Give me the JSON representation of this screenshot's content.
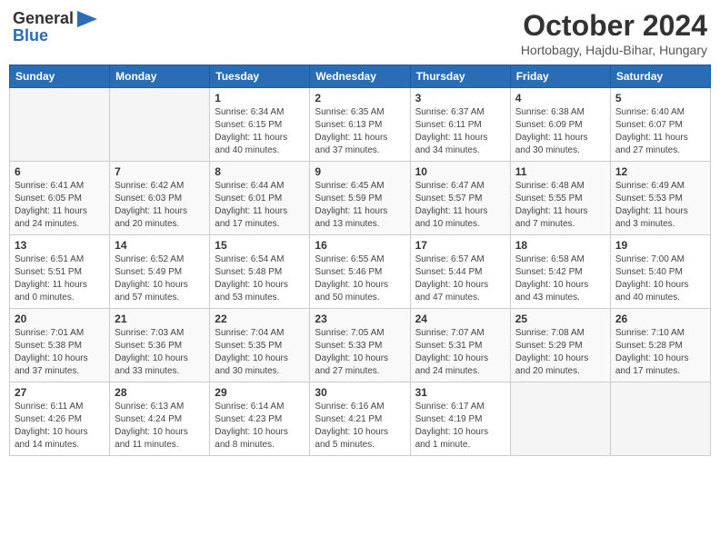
{
  "header": {
    "logo_general": "General",
    "logo_blue": "Blue",
    "month_title": "October 2024",
    "location": "Hortobagy, Hajdu-Bihar, Hungary"
  },
  "days_of_week": [
    "Sunday",
    "Monday",
    "Tuesday",
    "Wednesday",
    "Thursday",
    "Friday",
    "Saturday"
  ],
  "weeks": [
    [
      {
        "day": "",
        "info": ""
      },
      {
        "day": "",
        "info": ""
      },
      {
        "day": "1",
        "info": "Sunrise: 6:34 AM\nSunset: 6:15 PM\nDaylight: 11 hours\nand 40 minutes."
      },
      {
        "day": "2",
        "info": "Sunrise: 6:35 AM\nSunset: 6:13 PM\nDaylight: 11 hours\nand 37 minutes."
      },
      {
        "day": "3",
        "info": "Sunrise: 6:37 AM\nSunset: 6:11 PM\nDaylight: 11 hours\nand 34 minutes."
      },
      {
        "day": "4",
        "info": "Sunrise: 6:38 AM\nSunset: 6:09 PM\nDaylight: 11 hours\nand 30 minutes."
      },
      {
        "day": "5",
        "info": "Sunrise: 6:40 AM\nSunset: 6:07 PM\nDaylight: 11 hours\nand 27 minutes."
      }
    ],
    [
      {
        "day": "6",
        "info": "Sunrise: 6:41 AM\nSunset: 6:05 PM\nDaylight: 11 hours\nand 24 minutes."
      },
      {
        "day": "7",
        "info": "Sunrise: 6:42 AM\nSunset: 6:03 PM\nDaylight: 11 hours\nand 20 minutes."
      },
      {
        "day": "8",
        "info": "Sunrise: 6:44 AM\nSunset: 6:01 PM\nDaylight: 11 hours\nand 17 minutes."
      },
      {
        "day": "9",
        "info": "Sunrise: 6:45 AM\nSunset: 5:59 PM\nDaylight: 11 hours\nand 13 minutes."
      },
      {
        "day": "10",
        "info": "Sunrise: 6:47 AM\nSunset: 5:57 PM\nDaylight: 11 hours\nand 10 minutes."
      },
      {
        "day": "11",
        "info": "Sunrise: 6:48 AM\nSunset: 5:55 PM\nDaylight: 11 hours\nand 7 minutes."
      },
      {
        "day": "12",
        "info": "Sunrise: 6:49 AM\nSunset: 5:53 PM\nDaylight: 11 hours\nand 3 minutes."
      }
    ],
    [
      {
        "day": "13",
        "info": "Sunrise: 6:51 AM\nSunset: 5:51 PM\nDaylight: 11 hours\nand 0 minutes."
      },
      {
        "day": "14",
        "info": "Sunrise: 6:52 AM\nSunset: 5:49 PM\nDaylight: 10 hours\nand 57 minutes."
      },
      {
        "day": "15",
        "info": "Sunrise: 6:54 AM\nSunset: 5:48 PM\nDaylight: 10 hours\nand 53 minutes."
      },
      {
        "day": "16",
        "info": "Sunrise: 6:55 AM\nSunset: 5:46 PM\nDaylight: 10 hours\nand 50 minutes."
      },
      {
        "day": "17",
        "info": "Sunrise: 6:57 AM\nSunset: 5:44 PM\nDaylight: 10 hours\nand 47 minutes."
      },
      {
        "day": "18",
        "info": "Sunrise: 6:58 AM\nSunset: 5:42 PM\nDaylight: 10 hours\nand 43 minutes."
      },
      {
        "day": "19",
        "info": "Sunrise: 7:00 AM\nSunset: 5:40 PM\nDaylight: 10 hours\nand 40 minutes."
      }
    ],
    [
      {
        "day": "20",
        "info": "Sunrise: 7:01 AM\nSunset: 5:38 PM\nDaylight: 10 hours\nand 37 minutes."
      },
      {
        "day": "21",
        "info": "Sunrise: 7:03 AM\nSunset: 5:36 PM\nDaylight: 10 hours\nand 33 minutes."
      },
      {
        "day": "22",
        "info": "Sunrise: 7:04 AM\nSunset: 5:35 PM\nDaylight: 10 hours\nand 30 minutes."
      },
      {
        "day": "23",
        "info": "Sunrise: 7:05 AM\nSunset: 5:33 PM\nDaylight: 10 hours\nand 27 minutes."
      },
      {
        "day": "24",
        "info": "Sunrise: 7:07 AM\nSunset: 5:31 PM\nDaylight: 10 hours\nand 24 minutes."
      },
      {
        "day": "25",
        "info": "Sunrise: 7:08 AM\nSunset: 5:29 PM\nDaylight: 10 hours\nand 20 minutes."
      },
      {
        "day": "26",
        "info": "Sunrise: 7:10 AM\nSunset: 5:28 PM\nDaylight: 10 hours\nand 17 minutes."
      }
    ],
    [
      {
        "day": "27",
        "info": "Sunrise: 6:11 AM\nSunset: 4:26 PM\nDaylight: 10 hours\nand 14 minutes."
      },
      {
        "day": "28",
        "info": "Sunrise: 6:13 AM\nSunset: 4:24 PM\nDaylight: 10 hours\nand 11 minutes."
      },
      {
        "day": "29",
        "info": "Sunrise: 6:14 AM\nSunset: 4:23 PM\nDaylight: 10 hours\nand 8 minutes."
      },
      {
        "day": "30",
        "info": "Sunrise: 6:16 AM\nSunset: 4:21 PM\nDaylight: 10 hours\nand 5 minutes."
      },
      {
        "day": "31",
        "info": "Sunrise: 6:17 AM\nSunset: 4:19 PM\nDaylight: 10 hours\nand 1 minute."
      },
      {
        "day": "",
        "info": ""
      },
      {
        "day": "",
        "info": ""
      }
    ]
  ]
}
